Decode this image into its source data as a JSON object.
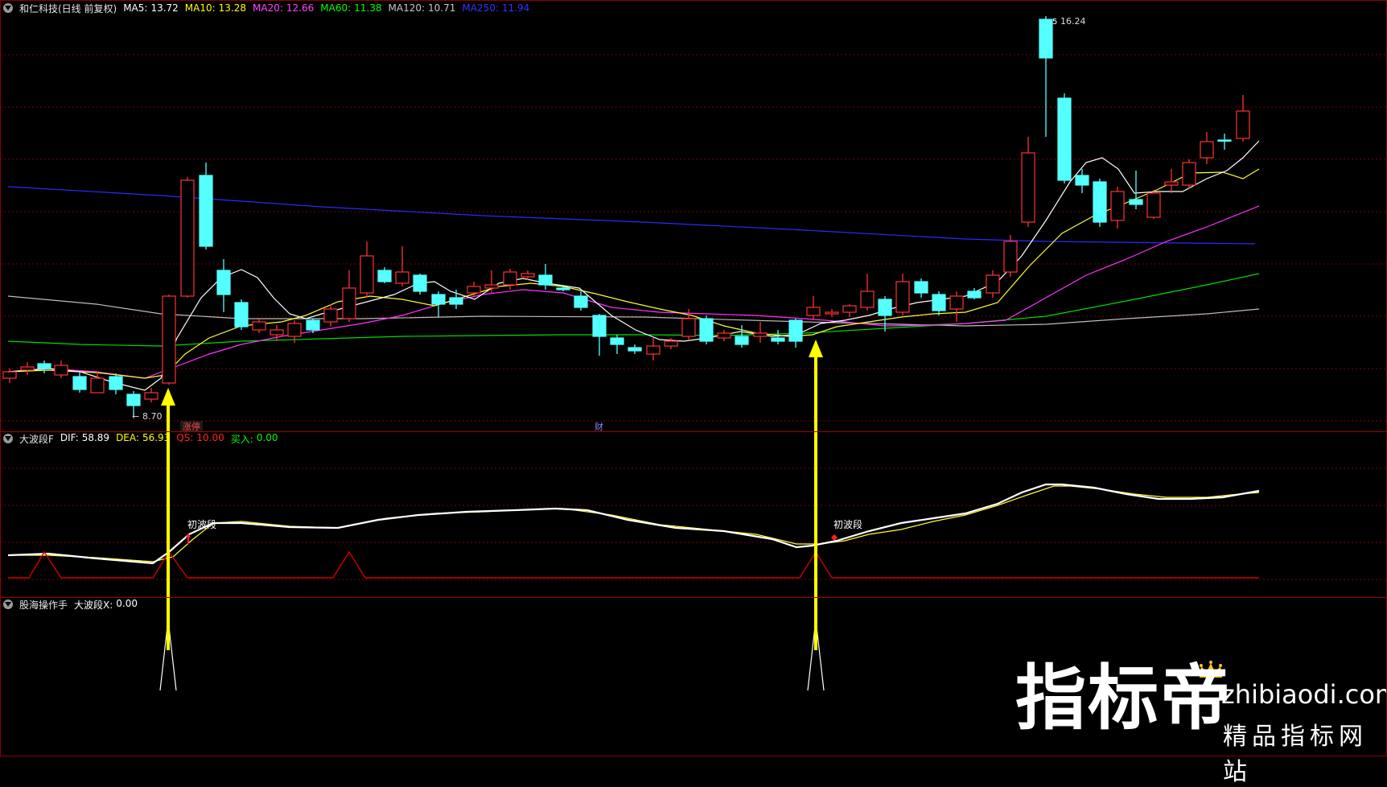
{
  "main_pane": {
    "title": "和仁科技(日线 前复权)",
    "indicators": [
      {
        "label": "MA5:",
        "value": "13.72",
        "color": "#ffffff"
      },
      {
        "label": "MA10:",
        "value": "13.28",
        "color": "#ffff00"
      },
      {
        "label": "MA20:",
        "value": "12.66",
        "color": "#ff44ff"
      },
      {
        "label": "MA60:",
        "value": "11.38",
        "color": "#00ff00"
      },
      {
        "label": "MA120:",
        "value": "10.71",
        "color": "#c8c8c8"
      },
      {
        "label": "MA250:",
        "value": "11.94",
        "color": "#3333ff"
      }
    ],
    "high_label": "16.24",
    "low_label": "8.70",
    "marker_zt": "涨停",
    "marker_cai": "财"
  },
  "sub_pane1": {
    "title": "大波段F",
    "items": [
      {
        "label": "DIF:",
        "value": "58.89",
        "color": "#ffffff"
      },
      {
        "label": "DEA:",
        "value": "56.93",
        "color": "#ffff00"
      },
      {
        "label": "QS:",
        "value": "10.00",
        "color": "#ff2222"
      },
      {
        "label": "买入:",
        "value": "0.00",
        "color": "#00ff00"
      }
    ],
    "signal_label_1": "初波段",
    "signal_label_2": "初波段"
  },
  "sub_pane2": {
    "title": "股海操作手",
    "items": [
      {
        "label": "大波段X:",
        "value": "0.00",
        "color": "#ffffff"
      }
    ]
  },
  "watermark": {
    "brand": "指标帝",
    "domain": "zhibiaodi.com",
    "tagline": "精品指标网站"
  },
  "colors": {
    "up": "#ff3333",
    "down": "#54ffff",
    "grid": "#7a0000",
    "arrow": "#ffff00"
  }
}
